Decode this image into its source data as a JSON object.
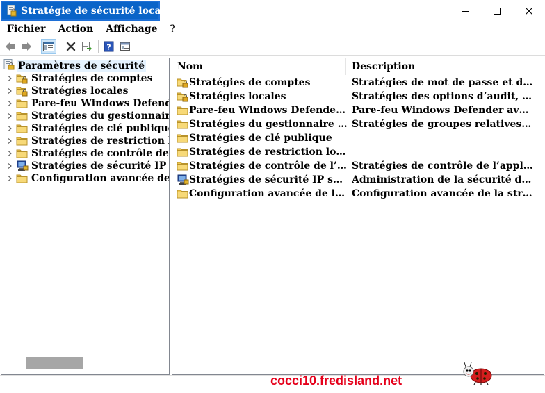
{
  "window": {
    "title": "Stratégie de sécurité locale",
    "accent_color": "#0a64c8"
  },
  "menu": {
    "items": [
      "Fichier",
      "Action",
      "Affichage",
      "?"
    ]
  },
  "toolbar": {
    "icons": [
      "back-arrow-icon",
      "forward-arrow-icon",
      "show-hide-console-tree-icon",
      "delete-icon",
      "export-list-icon",
      "help-icon",
      "properties-icon"
    ]
  },
  "tree": {
    "root_label": "Paramètres de sécurité",
    "items": [
      {
        "label": "Stratégies de comptes",
        "icon": "folder-lock-icon"
      },
      {
        "label": "Stratégies locales",
        "icon": "folder-lock-icon"
      },
      {
        "label": "Pare-feu Windows Defender",
        "icon": "folder-icon"
      },
      {
        "label": "Stratégies du gestionnaire d",
        "icon": "folder-icon"
      },
      {
        "label": "Stratégies de clé publique",
        "icon": "folder-icon"
      },
      {
        "label": "Stratégies de restriction log",
        "icon": "folder-icon"
      },
      {
        "label": "Stratégies de contrôle de l’ap",
        "icon": "folder-icon"
      },
      {
        "label": "Stratégies de sécurité IP sur",
        "icon": "ip-security-icon"
      },
      {
        "label": "Configuration avancée de la",
        "icon": "folder-icon"
      }
    ]
  },
  "list": {
    "columns": [
      "Nom",
      "Description"
    ],
    "rows": [
      {
        "name": "Stratégies de comptes",
        "description": "Stratégies de mot de passe et de ve...",
        "icon": "folder-lock-icon"
      },
      {
        "name": "Stratégies locales",
        "description": "Stratégies des options d’audit, de d...",
        "icon": "folder-lock-icon"
      },
      {
        "name": "Pare-feu Windows Defender a...",
        "description": "Pare-feu Windows Defender avec f...",
        "icon": "folder-icon"
      },
      {
        "name": "Stratégies du gestionnaire de ...",
        "description": "Stratégies de groupes relatives au ...",
        "icon": "folder-icon"
      },
      {
        "name": "Stratégies de clé publique",
        "description": "",
        "icon": "folder-icon"
      },
      {
        "name": "Stratégies de restriction logic...",
        "description": "",
        "icon": "folder-icon"
      },
      {
        "name": "Stratégies de contrôle de l’app...",
        "description": "Stratégies de contrôle de l’applicat...",
        "icon": "folder-icon"
      },
      {
        "name": "Stratégies de sécurité IP sur O...",
        "description": "Administration de la sécurité du p...",
        "icon": "ip-security-icon"
      },
      {
        "name": "Configuration avancée de la s...",
        "description": "Configuration avancée de la straté...",
        "icon": "folder-icon"
      }
    ]
  },
  "watermark": {
    "text": "cocci10.fredisland.net",
    "color": "#e5001b"
  }
}
